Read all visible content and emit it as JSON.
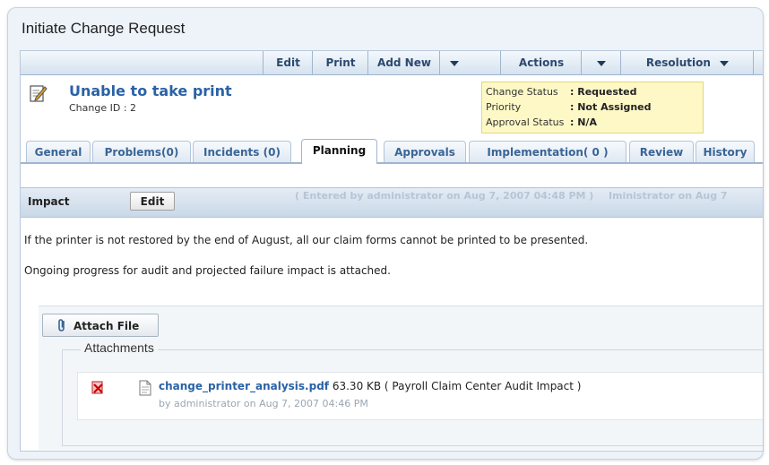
{
  "window": {
    "title": "Initiate Change Request"
  },
  "toolbar": {
    "edit": "Edit",
    "print": "Print",
    "add_new": "Add New",
    "actions": "Actions",
    "resolution": "Resolution"
  },
  "request": {
    "title": "Unable to take print",
    "change_id": "Change ID : 2"
  },
  "status": {
    "change_status_label": "Change Status",
    "change_status_value": ": Requested",
    "priority_label": "Priority",
    "priority_value": ": Not Assigned",
    "approval_status_label": "Approval Status",
    "approval_status_value": ": N/A"
  },
  "tabs": [
    {
      "label": "General"
    },
    {
      "label": "Problems(0)"
    },
    {
      "label": "Incidents (0)"
    },
    {
      "label": "Planning"
    },
    {
      "label": "Approvals"
    },
    {
      "label": "Implementation( 0 )"
    },
    {
      "label": "Review"
    },
    {
      "label": "History"
    }
  ],
  "impact": {
    "label": "Impact",
    "edit": "Edit",
    "entered": "( Entered by administrator on Aug 7, 2007 04:48 PM )",
    "entered_overflow": "Iministrator on Aug 7",
    "description_1": "If the printer is not restored by the end of August, all our claim forms cannot be printed to be presented.",
    "description_2": "Ongoing progress for audit and projected failure impact is attached."
  },
  "attachments": {
    "attach_button": "Attach File",
    "legend": "Attachments",
    "files": [
      {
        "name": "change_printer_analysis.pdf",
        "details": "63.30 KB ( Payroll Claim Center Audit Impact )",
        "by": "by administrator on Aug 7, 2007 04:46 PM"
      }
    ]
  },
  "icons": {
    "request": "edit-note-icon",
    "dropdown": "triangle-down-icon",
    "attach": "paperclip-icon",
    "delete": "delete-file-icon",
    "file": "document-icon"
  },
  "colors": {
    "link": "#2a62a6",
    "status_bg": "#fdf8c6",
    "toolbar_text": "#2c4a6e"
  }
}
